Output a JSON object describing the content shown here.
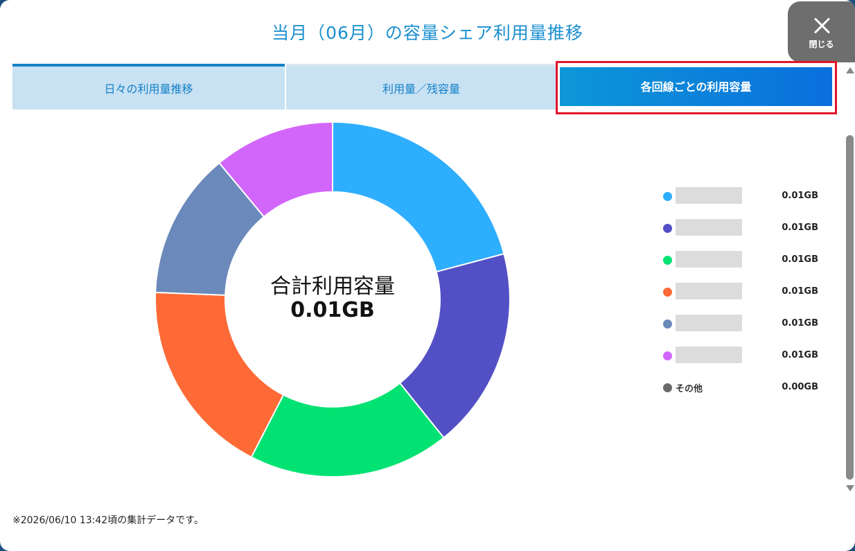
{
  "title": "当月（06月）の容量シェア利用量推移",
  "close": {
    "label": "閉じる",
    "icon": "close-icon"
  },
  "tabs": [
    {
      "label": "日々の利用量推移",
      "active": false
    },
    {
      "label": "利用量／残容量",
      "active": false
    },
    {
      "label": "各回線ごとの利用容量",
      "active": true
    }
  ],
  "center": {
    "label": "合計利用容量",
    "value": "0.01GB"
  },
  "chart_data": {
    "type": "pie",
    "categories": [
      "",
      "",
      "",
      "",
      "",
      "",
      "その他"
    ],
    "values": [
      20.8,
      18.3,
      18.3,
      18.0,
      13.3,
      11.0,
      0
    ],
    "colors": [
      "#2eaefe",
      "#5350c6",
      "#02e272",
      "#fe6a36",
      "#6b89ba",
      "#d266fb",
      "#6a6a6a"
    ]
  },
  "legend": [
    {
      "name": "",
      "value": "0.01GB",
      "color": "#2eaefe"
    },
    {
      "name": "",
      "value": "0.01GB",
      "color": "#5350c6"
    },
    {
      "name": "",
      "value": "0.01GB",
      "color": "#02e272"
    },
    {
      "name": "",
      "value": "0.01GB",
      "color": "#fe6a36"
    },
    {
      "name": "",
      "value": "0.01GB",
      "color": "#6b89ba"
    },
    {
      "name": "",
      "value": "0.01GB",
      "color": "#d266fb"
    },
    {
      "name": "その他",
      "value": "0.00GB",
      "color": "#6a6a6a"
    }
  ],
  "footnote": "※2026/06/10 13:42頃の集計データです。"
}
